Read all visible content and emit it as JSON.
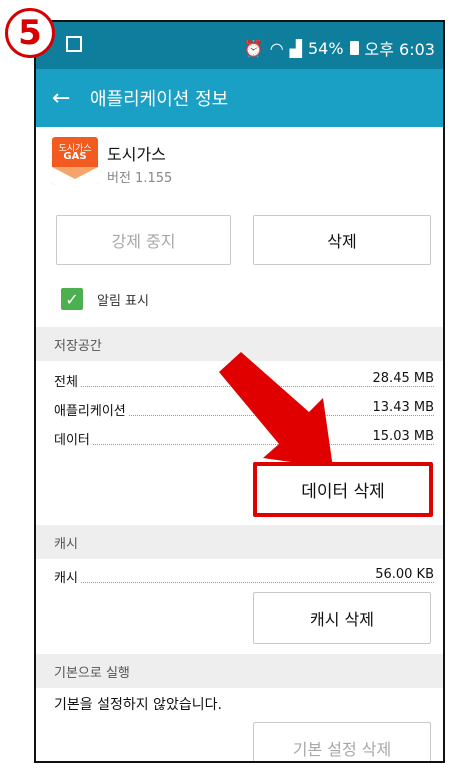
{
  "step_number": "5",
  "status_bar": {
    "battery": "54%",
    "time": "오후 6:03"
  },
  "app_bar": {
    "title": "애플리케이션 정보"
  },
  "app": {
    "icon_text_top": "도시가스",
    "icon_text_bottom": "GAS",
    "name": "도시가스",
    "version": "버전 1.155"
  },
  "buttons": {
    "force_stop": "강제 중지",
    "uninstall": "삭제",
    "clear_data": "데이터 삭제",
    "clear_cache": "캐시 삭제",
    "clear_defaults": "기본 설정 삭제"
  },
  "notifications": {
    "label": "알림 표시",
    "checked": true
  },
  "storage": {
    "header": "저장공간",
    "rows": [
      {
        "label": "전체",
        "value": "28.45 MB"
      },
      {
        "label": "애플리케이션",
        "value": "13.43 MB"
      },
      {
        "label": "데이터",
        "value": "15.03 MB"
      }
    ]
  },
  "cache": {
    "header": "캐시",
    "rows": [
      {
        "label": "캐시",
        "value": "56.00 KB"
      }
    ]
  },
  "defaults": {
    "header": "기본으로 실행",
    "text": "기본을 설정하지 않았습니다."
  },
  "colors": {
    "status_bar": "#0f7e9d",
    "app_bar": "#1aa0c4",
    "highlight": "#e00000",
    "checkbox": "#4caf50"
  }
}
